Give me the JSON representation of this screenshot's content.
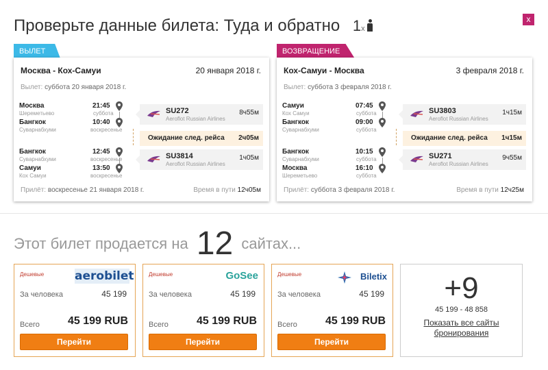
{
  "header": {
    "title_prefix": "Проверьте данные билета:",
    "trip_type": "Туда и обратно",
    "passengers": "1",
    "passengers_mult": "x",
    "close_label": "x"
  },
  "outbound": {
    "badge": "ВЫЛЕТ",
    "badge_color": "#3cb9e7",
    "route": "Москва - Кох-Самуи",
    "date": "20 января 2018 г.",
    "dep_label": "Вылет:",
    "dep_value": "суббота 20 января 2018 г.",
    "seg1": {
      "from_city": "Москва",
      "from_sub": "Шереметьево",
      "dep_time": "21:45",
      "dep_day": "суббота",
      "to_city": "Бангкок",
      "to_sub": "Суварнабхуми",
      "arr_time": "10:40",
      "arr_day": "воскресенье",
      "flight": "SU272",
      "airline": "Aeroflot Russian Airlines",
      "duration": "8ч55м"
    },
    "wait_label": "Ожидание след. рейса",
    "wait_duration": "2ч05м",
    "seg2": {
      "from_city": "Бангкок",
      "from_sub": "Суварнабхуми",
      "dep_time": "12:45",
      "dep_day": "воскресенье",
      "to_city": "Самуи",
      "to_sub": "Кох Самуи",
      "arr_time": "13:50",
      "arr_day": "воскресенье",
      "flight": "SU3814",
      "airline": "Aeroflot Russian Airlines",
      "duration": "1ч05м"
    },
    "arr_label": "Прилёт:",
    "arr_value": "воскресенье 21 января 2018 г.",
    "travel_label": "Время в пути",
    "travel_value": "12ч05м"
  },
  "return": {
    "badge": "ВОЗВРАЩЕНИЕ",
    "badge_color": "#c0246e",
    "route": "Кох-Самуи - Москва",
    "date": "3 февраля 2018 г.",
    "dep_label": "Вылет:",
    "dep_value": "суббота 3 февраля 2018 г.",
    "seg1": {
      "from_city": "Самуи",
      "from_sub": "Кох Самуи",
      "dep_time": "07:45",
      "dep_day": "суббота",
      "to_city": "Бангкок",
      "to_sub": "Суварнабхуми",
      "arr_time": "09:00",
      "arr_day": "суббота",
      "flight": "SU3803",
      "airline": "Aeroflot Russian Airlines",
      "duration": "1ч15м"
    },
    "wait_label": "Ожидание след. рейса",
    "wait_duration": "1ч15м",
    "seg2": {
      "from_city": "Бангкок",
      "from_sub": "Суварнабхуми",
      "dep_time": "10:15",
      "dep_day": "суббота",
      "to_city": "Москва",
      "to_sub": "Шереметьево",
      "arr_time": "16:10",
      "arr_day": "суббота",
      "flight": "SU271",
      "airline": "Aeroflot Russian Airlines",
      "duration": "9ч55м"
    },
    "arr_label": "Прилёт:",
    "arr_value": "суббота 3 февраля 2018 г.",
    "travel_label": "Время в пути",
    "travel_value": "12ч25м"
  },
  "offers": {
    "heading_pre": "Этот билет продается на",
    "count": "12",
    "heading_post": "сайтах...",
    "cards": [
      {
        "cheap": "Дешевые",
        "logo": "aerobilet",
        "per_label": "За человека",
        "per_value": "45 199",
        "total_label": "Всего",
        "total_value": "45 199 RUB",
        "button": "Перейти"
      },
      {
        "cheap": "Дешевые",
        "logo": "GoSee",
        "per_label": "За человека",
        "per_value": "45 199",
        "total_label": "Всего",
        "total_value": "45 199 RUB",
        "button": "Перейти"
      },
      {
        "cheap": "Дешевые",
        "logo": "Biletix",
        "per_label": "За человека",
        "per_value": "45 199",
        "total_label": "Всего",
        "total_value": "45 199 RUB",
        "button": "Перейти"
      }
    ],
    "more": {
      "plus": "+9",
      "range": "45 199 - 48 858",
      "link_line1": "Показать все сайты",
      "link_line2": "бронирования"
    }
  },
  "colors": {
    "accent_orange": "#f07e13",
    "aeroflot_purple": "#7a3b8f"
  }
}
